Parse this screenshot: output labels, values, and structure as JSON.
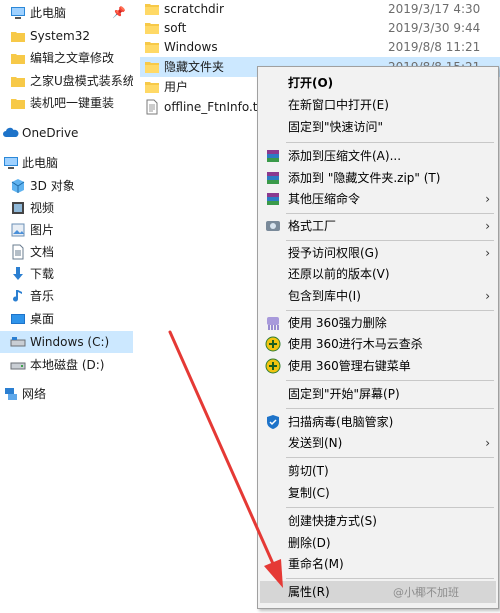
{
  "nav": {
    "items": [
      {
        "label": "此电脑",
        "icon": "pc-icon"
      },
      {
        "label": "System32",
        "icon": "folder-icon"
      },
      {
        "label": "编辑之文章修改",
        "icon": "folder-icon"
      },
      {
        "label": "之家U盘模式装系统",
        "icon": "folder-icon"
      },
      {
        "label": "装机吧一键重装",
        "icon": "folder-icon"
      },
      {
        "label": "OneDrive",
        "icon": "cloud-icon"
      },
      {
        "label": "此电脑",
        "icon": "pc-icon"
      },
      {
        "label": "3D 对象",
        "icon": "3d-objects-icon"
      },
      {
        "label": "视频",
        "icon": "video-icon"
      },
      {
        "label": "图片",
        "icon": "pictures-icon"
      },
      {
        "label": "文档",
        "icon": "documents-icon"
      },
      {
        "label": "下载",
        "icon": "download-icon"
      },
      {
        "label": "音乐",
        "icon": "music-icon"
      },
      {
        "label": "桌面",
        "icon": "desktop-icon"
      },
      {
        "label": "Windows (C:)",
        "icon": "drive-c-icon"
      },
      {
        "label": "本地磁盘 (D:)",
        "icon": "drive-d-icon"
      },
      {
        "label": "网络",
        "icon": "network-icon"
      }
    ]
  },
  "files": [
    {
      "name": "scratchdir",
      "date": "2019/3/17 4:30"
    },
    {
      "name": "soft",
      "date": "2019/3/30 9:44"
    },
    {
      "name": "Windows",
      "date": "2019/8/8 11:21"
    },
    {
      "name": "隐藏文件夹",
      "date": "2019/8/8 15:21"
    },
    {
      "name": "用户",
      "date": ""
    },
    {
      "name": "offline_FtnInfo.txt",
      "date": ""
    }
  ],
  "menu": {
    "items": [
      {
        "label": "打开(O)"
      },
      {
        "label": "在新窗口中打开(E)"
      },
      {
        "label": "固定到\"快速访问\""
      },
      {
        "label": "添加到压缩文件(A)..."
      },
      {
        "label": "添加到 \"隐藏文件夹.zip\" (T)"
      },
      {
        "label": "其他压缩命令"
      },
      {
        "label": "格式工厂"
      },
      {
        "label": "授予访问权限(G)"
      },
      {
        "label": "还原以前的版本(V)"
      },
      {
        "label": "包含到库中(I)"
      },
      {
        "label": "使用 360强力删除"
      },
      {
        "label": "使用 360进行木马云查杀"
      },
      {
        "label": "使用 360管理右键菜单"
      },
      {
        "label": "固定到\"开始\"屏幕(P)"
      },
      {
        "label": "扫描病毒(电脑管家)"
      },
      {
        "label": "发送到(N)"
      },
      {
        "label": "剪切(T)"
      },
      {
        "label": "复制(C)"
      },
      {
        "label": "创建快捷方式(S)"
      },
      {
        "label": "删除(D)"
      },
      {
        "label": "重命名(M)"
      },
      {
        "label": "属性(R)"
      }
    ]
  },
  "watermark": "@小椰不加班",
  "colors": {
    "selection": "#cce8ff",
    "folder": "#f7c948",
    "annotation_arrow": "#e53935",
    "menu_bg": "#f2f2f2"
  }
}
